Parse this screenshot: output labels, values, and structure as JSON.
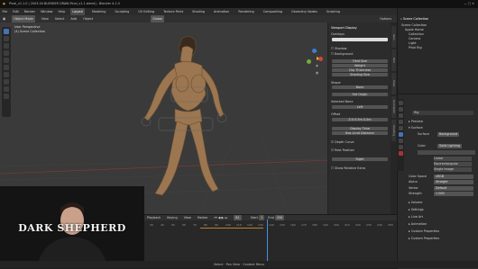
{
  "titlebar": {
    "title": "Pinal_v1.1.0 | 2003-04 BLENDER DRAW-Pinal_v1.1.blend] - Blender 4.1.0"
  },
  "menubar": {
    "items": [
      "File",
      "Edit",
      "Render",
      "Window",
      "Help"
    ],
    "workspaces": [
      "Layout",
      "Modeling",
      "Sculpting",
      "UV Editing",
      "Texture Paint",
      "Shading",
      "Animation",
      "Rendering",
      "Compositing",
      "Geometry Nodes",
      "Scripting"
    ],
    "active_workspace": "Layout",
    "scene": "Scene",
    "view_layer": "View Layer"
  },
  "viewport": {
    "mode": "Object Mode",
    "menu": [
      "View",
      "Select",
      "Add",
      "Object"
    ],
    "orientation": "Global",
    "overlay_text": [
      "User Perspective",
      "(4) Scene Collection"
    ],
    "options_label": "Options"
  },
  "npanel": {
    "viewport_display": "Viewport Display",
    "tabs": [
      "Item",
      "Tool",
      "View",
      "Animation",
      "Shading"
    ],
    "rows": [
      {
        "label": "Overlays"
      },
      {
        "label": "Image"
      },
      {
        "label": "Shadow"
      },
      {
        "label": "Background"
      },
      {
        "label": "Field Size"
      },
      {
        "label": "Weight"
      },
      {
        "label": "Clip Thickness"
      },
      {
        "label": "Shading Size"
      },
      {
        "label": "Shape"
      },
      {
        "label": "Bone"
      },
      {
        "label": "Selected Bone"
      },
      {
        "label": "Onion Skinning"
      },
      {
        "label": "Display Time"
      },
      {
        "label": "Box Limit Distance"
      },
      {
        "label": "Depth Curve"
      },
      {
        "label": "Rest Position"
      },
      {
        "label": "Show Relative Extra"
      }
    ],
    "buttons": [
      "Set Origin",
      "Left",
      "Right"
    ],
    "offset_label": "Offset",
    "offset_values": [
      "Z:0",
      "0.5m",
      "0.5m"
    ]
  },
  "outliner": {
    "title": "Scene Collection",
    "items": [
      "Scene Collection",
      "Apple Home",
      "Collection",
      "Camera",
      "Light",
      "Pinal Rig"
    ]
  },
  "properties": {
    "object_name": "Rig",
    "sections": [
      "Preview",
      "Surface",
      "Volume",
      "Settings",
      "Line Art",
      "Animation",
      "Custom Properties",
      "Custom Properties"
    ],
    "fields": [
      {
        "label": "Surface",
        "value": "Background"
      },
      {
        "label": "Color",
        "value": "Solid Lighting"
      },
      {
        "label": "Strength",
        "value": "1.000"
      },
      {
        "label": "Linear",
        "value": "Linear"
      },
      {
        "label": "Equirectangular",
        "value": "Equirectangular"
      },
      {
        "label": "Single Image",
        "value": "Single Image"
      },
      {
        "label": "Color Space",
        "value": "sRGB"
      },
      {
        "label": "Alpha",
        "value": "Straight"
      },
      {
        "label": "Vector",
        "value": "Default"
      },
      {
        "label": "Strength",
        "value": "1.000"
      }
    ]
  },
  "timeline": {
    "menu": [
      "Playback",
      "Keying",
      "View",
      "Marker"
    ],
    "frames": [
      "30",
      "40",
      "50",
      "60",
      "70",
      "80",
      "90",
      "100",
      "110",
      "120",
      "130",
      "140",
      "150",
      "160",
      "170",
      "180",
      "190",
      "200",
      "210",
      "220",
      "230",
      "240",
      "250"
    ],
    "current_frame": "81",
    "start_label": "Start",
    "start": "1",
    "end_label": "End",
    "end": "250"
  },
  "statusbar": {
    "text": "Select  ·  Pan View  ·  Context Menu"
  },
  "webcam": {
    "logo": "DARK SHEPHERD"
  },
  "colors": {
    "accent": "#4772b3",
    "keyframe_bar": "#c77d2a",
    "playhead": "#4a8fe0"
  }
}
